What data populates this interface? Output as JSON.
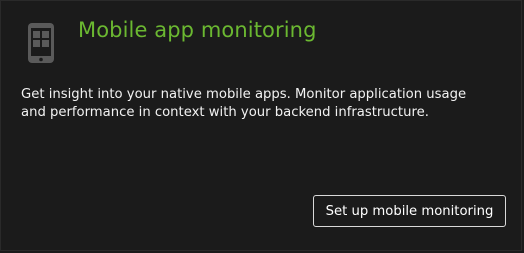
{
  "card": {
    "icon": "mobile-phone-icon",
    "title": "Mobile app monitoring",
    "description": "Get insight into your native mobile apps. Monitor application usage and performance in context with your backend infrastructure.",
    "button_label": "Set up mobile monitoring"
  },
  "colors": {
    "background": "#1b1b1b",
    "accent": "#6bb831",
    "text": "#f2f2f2",
    "icon": "#5a5a5a",
    "button_border": "#d9d9d9"
  }
}
